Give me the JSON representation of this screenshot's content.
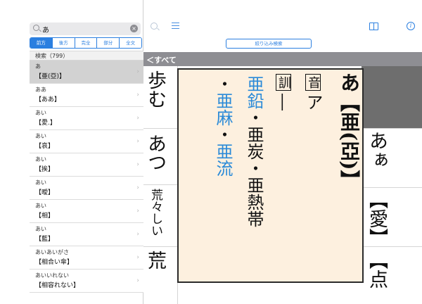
{
  "search": {
    "query": "あ",
    "clear_label": "×"
  },
  "mode_tabs": [
    {
      "label": "前方",
      "active": true
    },
    {
      "label": "後方",
      "active": false
    },
    {
      "label": "完全",
      "active": false
    },
    {
      "label": "部分",
      "active": false
    },
    {
      "label": "全文",
      "active": false
    }
  ],
  "results": {
    "header": "検索（799）",
    "items": [
      {
        "reading": "あ",
        "word": "【亜(亞)】",
        "selected": true
      },
      {
        "reading": "ああ",
        "word": "【ああ】",
        "selected": false
      },
      {
        "reading": "あい",
        "word": "【愛.】",
        "selected": false
      },
      {
        "reading": "あい",
        "word": "【哀】",
        "selected": false
      },
      {
        "reading": "あい",
        "word": "【挨】",
        "selected": false
      },
      {
        "reading": "あい",
        "word": "【曖】",
        "selected": false
      },
      {
        "reading": "あい",
        "word": "【相】",
        "selected": false
      },
      {
        "reading": "あい",
        "word": "【藍】",
        "selected": false
      },
      {
        "reading": "あいあいがさ",
        "word": "【相合い傘】",
        "selected": false
      },
      {
        "reading": "あいいれない",
        "word": "【相容れない】",
        "selected": false
      }
    ]
  },
  "toolbar": {
    "filter_label": "絞り込み検索",
    "info_glyph": "i"
  },
  "category": {
    "label": "＜すべて"
  },
  "background": {
    "col1": [
      "歩む",
      "あつ",
      "荒々しい",
      "荒"
    ],
    "col2": [
      "あぁ",
      "【愛】",
      "【点"
    ]
  },
  "popup": {
    "heading": "あ【亜(亞)】",
    "on_label": "音",
    "on_reading": "ア",
    "kun_label": "訓",
    "kun_reading": "―",
    "compounds_line1_blue": "亜鉛",
    "compounds_line1_rest": "・亜炭・亜熱帯",
    "compounds_line2_prefix": "・",
    "compounds_line2_blue1": "亜麻",
    "compounds_line2_sep": "・",
    "compounds_line2_blue2": "亜流"
  }
}
